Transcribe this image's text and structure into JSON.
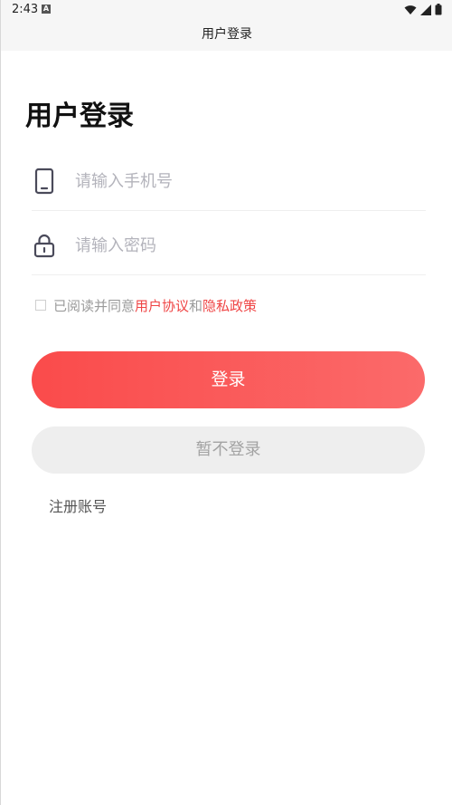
{
  "status_bar": {
    "time": "2:43",
    "badge": "A",
    "icons": [
      "wifi-icon",
      "signal-icon",
      "battery-icon"
    ]
  },
  "app_bar": {
    "title": "用户登录"
  },
  "page": {
    "heading": "用户登录"
  },
  "phone_field": {
    "placeholder": "请输入手机号",
    "icon": "phone-icon"
  },
  "password_field": {
    "placeholder": "请输入密码",
    "icon": "lock-icon"
  },
  "agreement": {
    "prefix": "已阅读并同意",
    "user_agreement": "用户协议",
    "conjunction": "和",
    "privacy_policy": "隐私政策",
    "checked": false
  },
  "buttons": {
    "login": "登录",
    "skip": "暂不登录",
    "register": "注册账号"
  },
  "colors": {
    "accent_start": "#fa4b4b",
    "accent_end": "#fb6a6a",
    "link": "#ef4545"
  }
}
